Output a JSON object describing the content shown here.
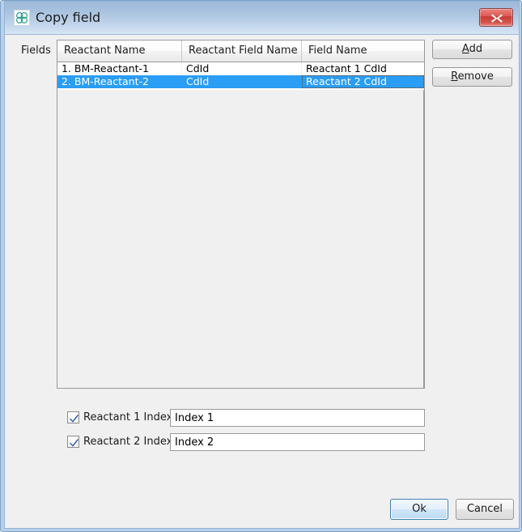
{
  "window": {
    "title": "Copy field",
    "icon": "molecule-icon",
    "close_icon": "close-icon",
    "accent_selection": "#2a9df4",
    "titlebar_color": "#a7c1de",
    "close_color": "#c63c34"
  },
  "form": {
    "fields_label": "Fields"
  },
  "table": {
    "columns": [
      "Reactant Name",
      "Reactant Field Name",
      "Field Name"
    ],
    "rows": [
      {
        "reactant_name": "1. BM-Reactant-1",
        "reactant_field_name": "CdId",
        "field_name": "Reactant 1 CdId",
        "selected": false
      },
      {
        "reactant_name": "2. BM-Reactant-2",
        "reactant_field_name": "CdId",
        "field_name": "Reactant 2 CdId",
        "selected": true
      }
    ]
  },
  "side_buttons": {
    "add": {
      "prefix": "",
      "mnemonic": "A",
      "suffix": "dd"
    },
    "remove": {
      "prefix": "",
      "mnemonic": "R",
      "suffix": "emove"
    }
  },
  "options": [
    {
      "label": "Reactant 1 Index",
      "checked": true,
      "value": "Index 1",
      "placeholder": "Index 1"
    },
    {
      "label": "Reactant 2 Index",
      "checked": true,
      "value": "Index 2",
      "placeholder": "Index 2"
    }
  ],
  "footer": {
    "ok": "Ok",
    "cancel": "Cancel"
  }
}
